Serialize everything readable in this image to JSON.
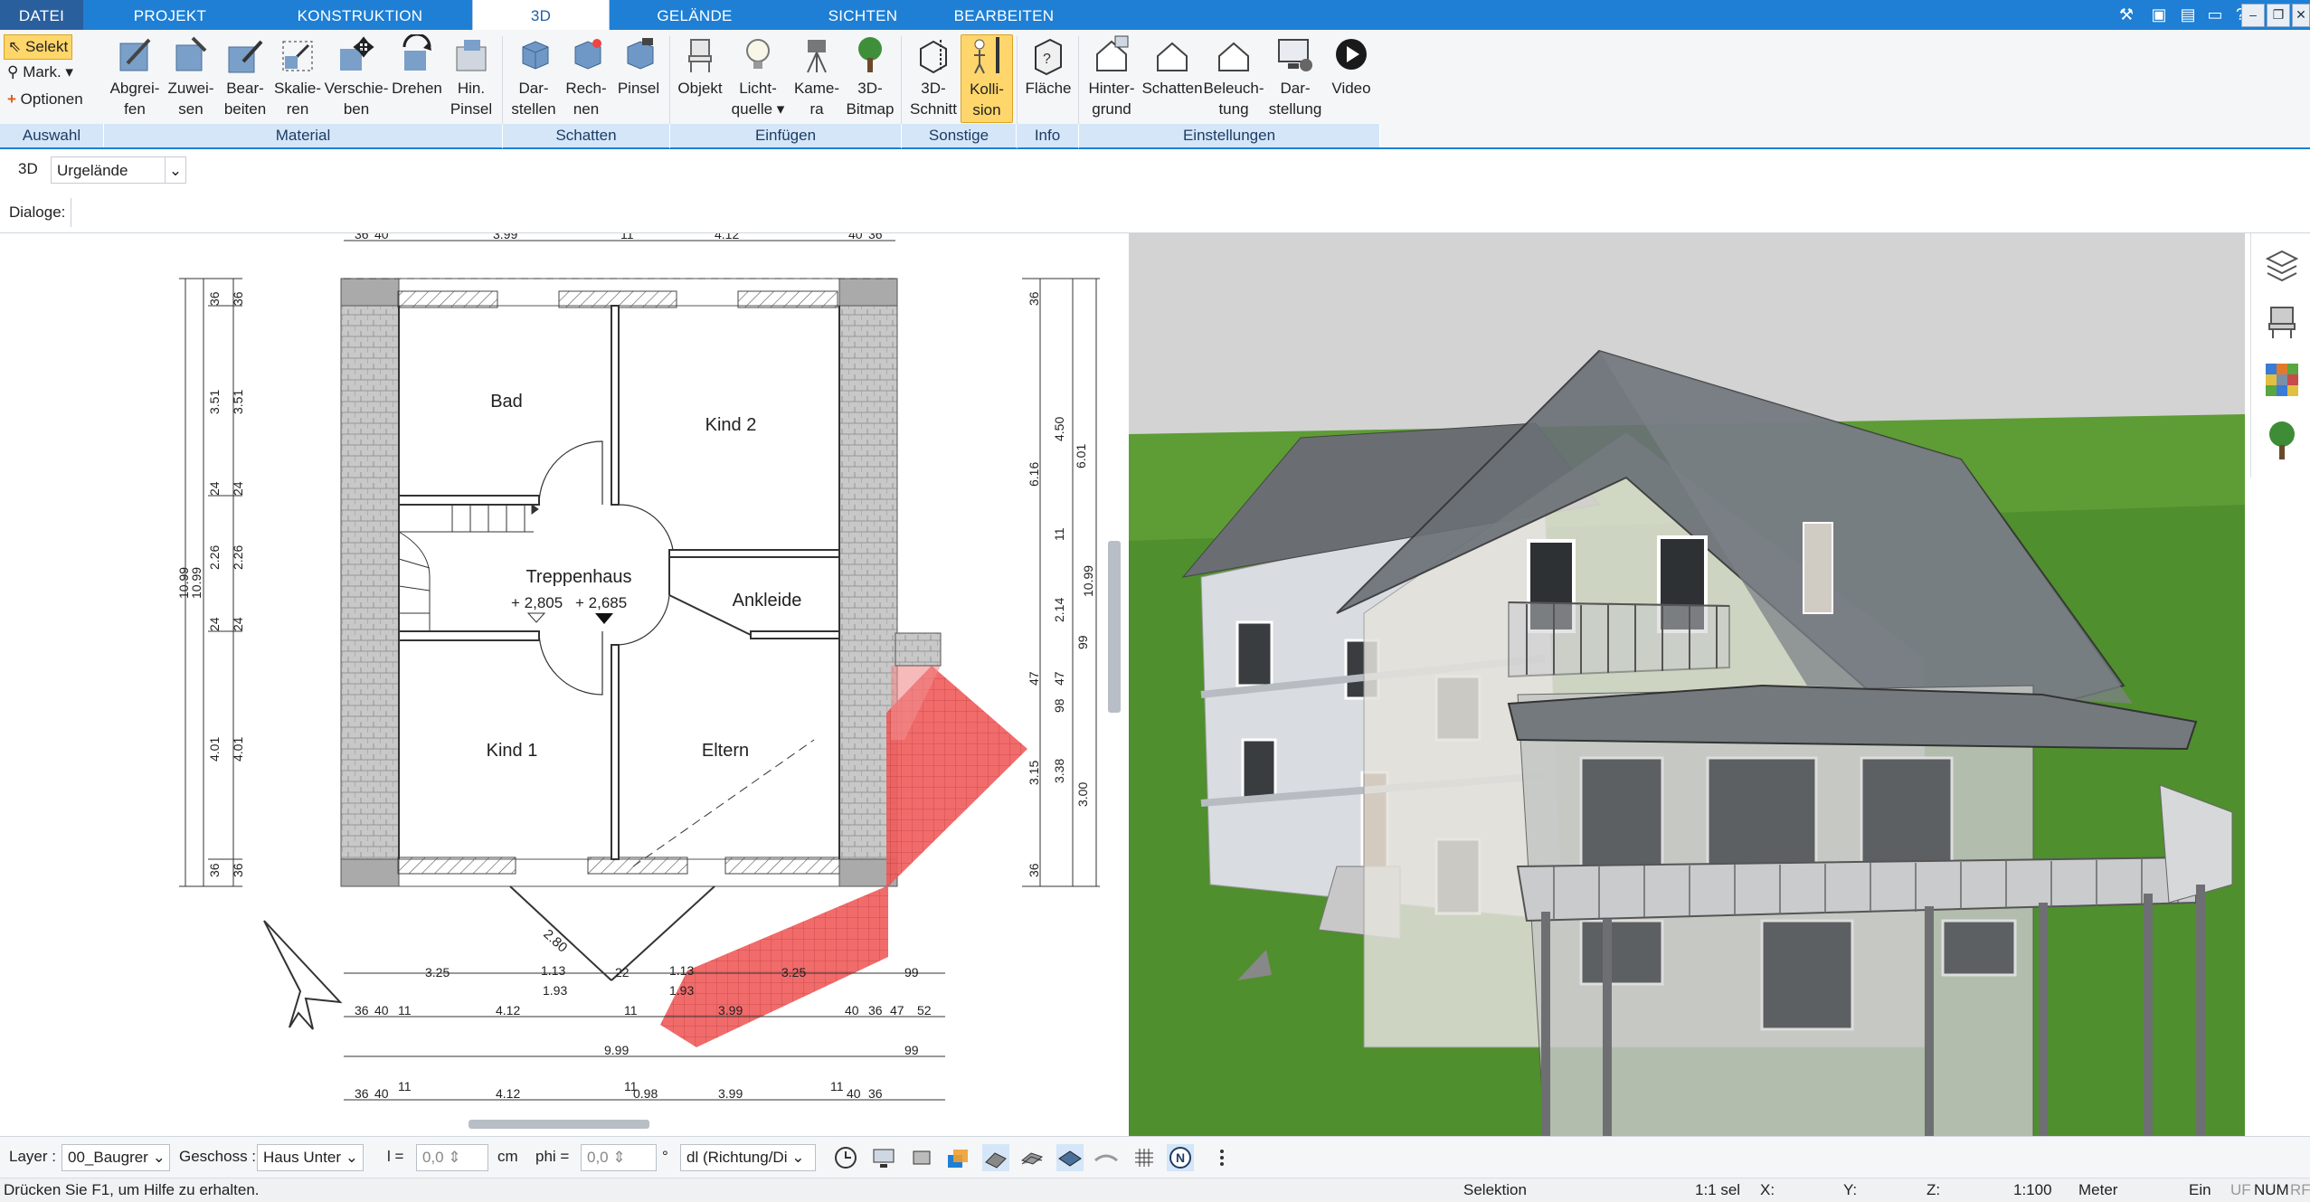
{
  "tabs": [
    "DATEI",
    "PROJEKT",
    "KONSTRUKTION",
    "3D",
    "GELÄNDE",
    "SICHTEN",
    "BEARBEITEN"
  ],
  "selection": {
    "selekt": "Selekt",
    "mark": "Mark.",
    "optionen": "Optionen"
  },
  "ribbon": {
    "material": [
      {
        "l1": "Abgrei-",
        "l2": "fen"
      },
      {
        "l1": "Zuwei-",
        "l2": "sen"
      },
      {
        "l1": "Bear-",
        "l2": "beiten"
      },
      {
        "l1": "Skalie-",
        "l2": "ren"
      },
      {
        "l1": "Verschie-",
        "l2": "ben"
      },
      {
        "l1": "Drehen",
        "l2": ""
      },
      {
        "l1": "Hin.",
        "l2": "Pinsel"
      }
    ],
    "schatten": [
      {
        "l1": "Dar-",
        "l2": "stellen"
      },
      {
        "l1": "Rech-",
        "l2": "nen"
      },
      {
        "l1": "Pinsel",
        "l2": ""
      }
    ],
    "einfuegen": [
      {
        "l1": "Objekt",
        "l2": ""
      },
      {
        "l1": "Licht-",
        "l2": "quelle"
      },
      {
        "l1": "Kame-",
        "l2": "ra"
      },
      {
        "l1": "3D-",
        "l2": "Bitmap"
      }
    ],
    "sonstige": [
      {
        "l1": "3D-",
        "l2": "Schnitt"
      },
      {
        "l1": "Kolli-",
        "l2": "sion"
      }
    ],
    "info": [
      {
        "l1": "Fläche",
        "l2": ""
      }
    ],
    "einstellungen": [
      {
        "l1": "Hinter-",
        "l2": "grund"
      },
      {
        "l1": "Schatten",
        "l2": ""
      },
      {
        "l1": "Beleuch-",
        "l2": "tung"
      },
      {
        "l1": "Dar-",
        "l2": "stellung"
      },
      {
        "l1": "Video",
        "l2": ""
      }
    ]
  },
  "groups": {
    "auswahl": "Auswahl",
    "material": "Material",
    "schatten": "Schatten",
    "einfuegen": "Einfügen",
    "sonstige": "Sonstige",
    "info": "Info",
    "einstellungen": "Einstellungen"
  },
  "row2": {
    "mode": "3D",
    "dropdown": "Urgelände"
  },
  "row3": {
    "dialoge": "Dialoge:"
  },
  "plan": {
    "rooms": [
      "Bad",
      "Kind 2",
      "Treppenhaus",
      "Ankleide",
      "Kind 1",
      "Eltern"
    ],
    "level1": "+ 2,805",
    "level2": "+ 2,685",
    "dims_top": [
      "36",
      "40",
      "3.99",
      "11",
      "4.12",
      "40",
      "36"
    ],
    "dims_bottom1": [
      "3.25",
      "1.13",
      "1.93",
      "22",
      "1.13",
      "1.93",
      "3.25",
      "99"
    ],
    "dims_bottom2": [
      "36",
      "40",
      "11",
      "4.12",
      "11",
      "3.99",
      "40",
      "36",
      "47",
      "52"
    ],
    "dims_bottom3": [
      "9.99",
      "99"
    ],
    "dims_bottom4": [
      "36",
      "40",
      "11",
      "4.12",
      "11",
      "0.98",
      "3.99",
      "11",
      "40",
      "36"
    ],
    "dims_left": [
      "36",
      "36",
      "3.51",
      "3.51",
      "24",
      "24",
      "2.26",
      "2.26",
      "10.99",
      "10.99",
      "24",
      "24",
      "4.01",
      "4.01",
      "36",
      "36"
    ],
    "dims_right": [
      "36",
      "4.50",
      "6.16",
      "6.01",
      "11",
      "2.14",
      "10.99",
      "99",
      "47",
      "47",
      "98",
      "3.15",
      "3.38",
      "3.00",
      "36"
    ],
    "diag": "2.80"
  },
  "bottombar": {
    "layer_label": "Layer :",
    "layer_value": "00_Baugrer",
    "geschoss_label": "Geschoss :",
    "geschoss_value": "Haus Unter",
    "l_label": "l =",
    "l_value": "0,0",
    "l_unit": "cm",
    "phi_label": "phi =",
    "phi_value": "0,0",
    "phi_unit": "°",
    "dl_value": "dl (Richtung/Di"
  },
  "status": {
    "help": "Drücken Sie F1, um Hilfe zu erhalten.",
    "mode": "Selektion",
    "sel": "1:1 sel",
    "x": "X:",
    "y": "Y:",
    "z": "Z:",
    "scale": "1:100",
    "unit": "Meter",
    "ein": "Ein",
    "uf": "UF",
    "num": "NUM",
    "rf": "RF"
  },
  "colors": {
    "accent": "#1e7fd4",
    "ribbon_group": "#d4e6f8",
    "selected": "#ffd66b",
    "collision": "#f0505a"
  }
}
